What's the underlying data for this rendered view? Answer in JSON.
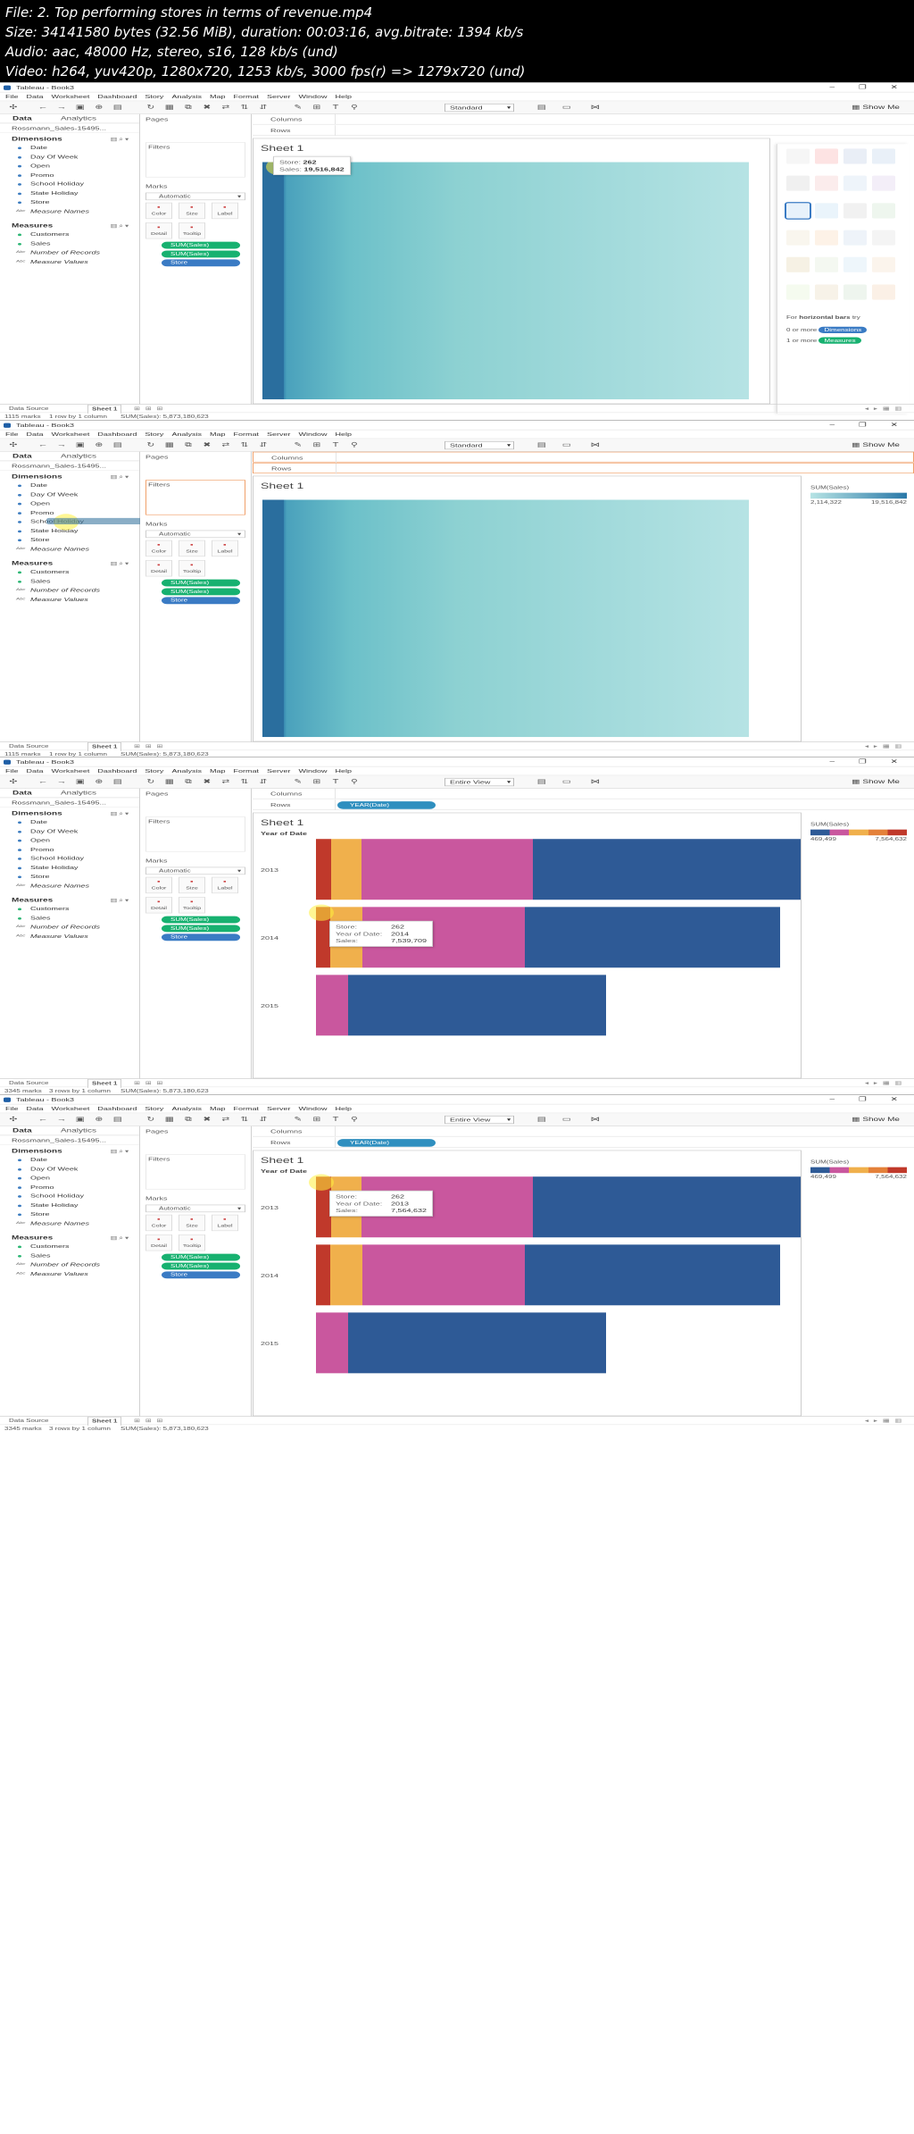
{
  "header": {
    "line1": "File: 2. Top performing stores in terms of revenue.mp4",
    "line2": "Size: 34141580 bytes (32.56 MiB), duration: 00:03:16, avg.bitrate: 1394 kb/s",
    "line3": "Audio: aac, 48000 Hz, stereo, s16, 128 kb/s (und)",
    "line4": "Video: h264, yuv420p, 1280x720, 1253 kb/s, 3000 fps(r) => 1279x720 (und)"
  },
  "app": {
    "title": "Tableau - Book3",
    "menu": [
      "File",
      "Data",
      "Worksheet",
      "Dashboard",
      "Story",
      "Analysis",
      "Map",
      "Format",
      "Server",
      "Window",
      "Help"
    ],
    "show_me": "Show Me",
    "data_tab": "Data",
    "analytics_tab": "Analytics",
    "datasource": "Rossmann_Sales-15495...",
    "dimensions_label": "Dimensions",
    "dimensions": [
      "Date",
      "Day Of Week",
      "Open",
      "Promo",
      "School Holiday",
      "State Holiday",
      "Store",
      "Measure Names"
    ],
    "measures_label": "Measures",
    "measures": [
      "Customers",
      "Sales",
      "Number of Records",
      "Measure Values"
    ],
    "pages_label": "Pages",
    "filters_label": "Filters",
    "marks_label": "Marks",
    "marks_type": "Automatic",
    "mark_buttons": [
      "Color",
      "Size",
      "Label",
      "Detail",
      "Tooltip"
    ],
    "mark_pills": [
      "SUM(Sales)",
      "SUM(Sales)",
      "Store"
    ],
    "columns_label": "Columns",
    "rows_label": "Rows",
    "sheet_title": "Sheet 1",
    "datasource_tab": "Data Source",
    "sheet_tab": "Sheet 1",
    "sum_sales_status": "SUM(Sales): 5,873,180,623"
  },
  "frames": [
    {
      "fit": "Standard",
      "marks_count": "1115 marks",
      "rows_cols": "1 row by 1 column",
      "tooltip": {
        "store_label": "Store:",
        "store": "262",
        "sales_label": "Sales:",
        "sales": "19,516,842"
      },
      "showme": {
        "hint_prefix": "For",
        "hint_bold": "horizontal bars",
        "hint_suffix": "try",
        "dim_need": "0 or more",
        "dim_tag": "Dimensions",
        "meas_need": "1 or more",
        "meas_tag": "Measures"
      }
    },
    {
      "fit": "Standard",
      "marks_count": "1115 marks",
      "rows_cols": "1 row by 1 column",
      "legend": {
        "title": "SUM(Sales)",
        "min": "2,114,322",
        "max": "19,516,842"
      }
    },
    {
      "fit": "Entire View",
      "marks_count": "3345 marks",
      "rows_cols": "3 rows by 1 column",
      "rows_pill": "YEAR(Date)",
      "year_header": "Year of Date",
      "years": [
        "2013",
        "2014",
        "2015"
      ],
      "legend": {
        "title": "SUM(Sales)",
        "min": "469,499",
        "max": "7,564,632"
      },
      "tooltip": {
        "store_label": "Store:",
        "store": "262",
        "year_label": "Year of Date:",
        "year": "2014",
        "sales_label": "Sales:",
        "sales": "7,539,709"
      }
    },
    {
      "fit": "Entire View",
      "marks_count": "3345 marks",
      "rows_cols": "3 rows by 1 column",
      "rows_pill": "YEAR(Date)",
      "year_header": "Year of Date",
      "years": [
        "2013",
        "2014",
        "2015"
      ],
      "legend": {
        "title": "SUM(Sales)",
        "min": "469,499",
        "max": "7,564,632"
      },
      "tooltip": {
        "store_label": "Store:",
        "store": "262",
        "year_label": "Year of Date:",
        "year": "2013",
        "sales_label": "Sales:",
        "sales": "7,564,632"
      }
    }
  ],
  "colors": {
    "teal_dark": "#2a78a8",
    "teal_light": "#b6e3e4",
    "navy": "#2e5a96",
    "magenta": "#c9579e",
    "orange": "#f0b04c",
    "red": "#c0392b",
    "green_pill": "#17b170"
  }
}
